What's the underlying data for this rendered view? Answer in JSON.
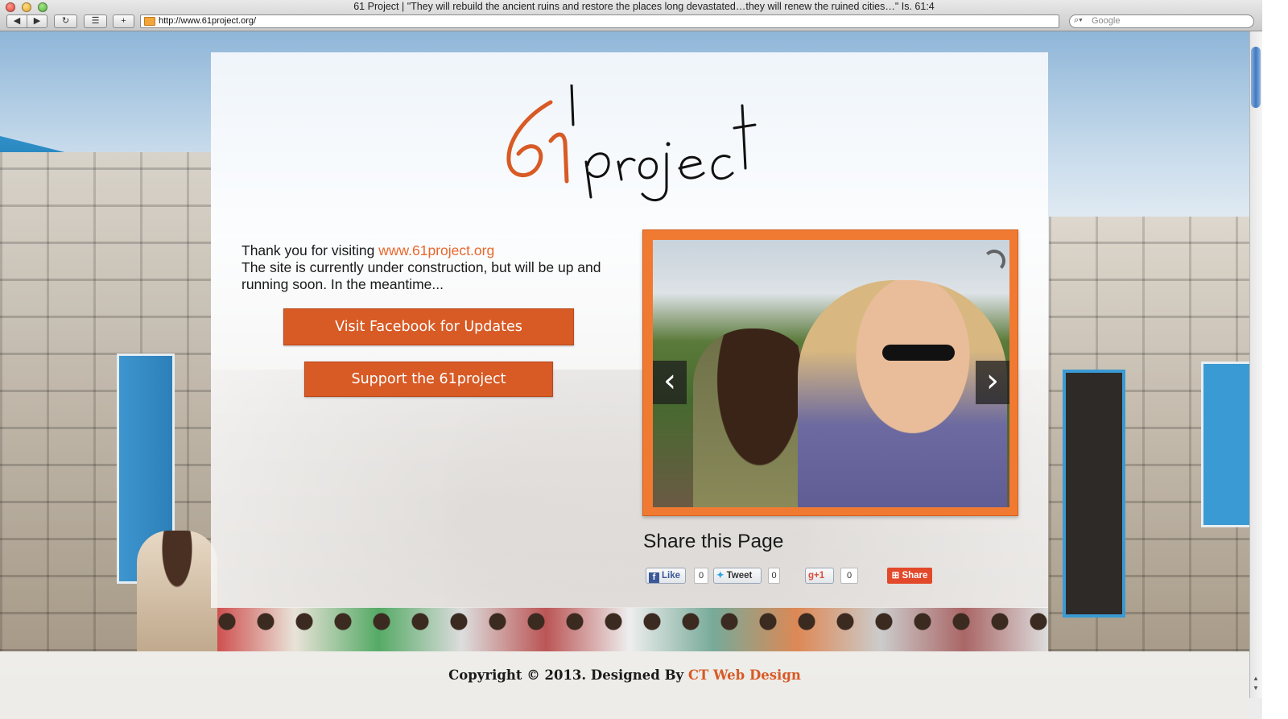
{
  "browser": {
    "window_title": "61 Project | \"They will rebuild the ancient ruins and restore the places long devastated…they will renew the ruined cities…\" Is. 61:4",
    "url": "http://www.61project.org/",
    "search_placeholder": "Google",
    "new_tab_label": "+",
    "icons": {
      "back": "back-arrow-icon",
      "forward": "forward-arrow-icon",
      "reload": "reload-icon",
      "bookmarks": "bookmarks-icon",
      "search": "search-icon"
    }
  },
  "page": {
    "logo_text": "61project",
    "intro": {
      "line1_prefix": "Thank you for visiting ",
      "site_link": "www.61project.org",
      "line2": "The site is currently under construction, but will be up and running soon.  In the meantime..."
    },
    "buttons": {
      "facebook": "Visit Facebook for Updates",
      "support": "Support the 61project"
    },
    "slider": {
      "prev_glyph": "‹",
      "next_glyph": "›"
    },
    "share": {
      "title": "Share this Page",
      "like_label": "Like",
      "like_count": "0",
      "tweet_label": "Tweet",
      "tweet_count": "0",
      "gplus_label": "+1",
      "gplus_count": "0",
      "share_label": "Share"
    },
    "footer": {
      "copyright": "Copyright © 2013. Designed By ",
      "designer": "CT Web Design"
    }
  },
  "colors": {
    "accent_orange": "#d85a25",
    "link_orange": "#e8672c",
    "frame_orange": "#f07a32"
  }
}
